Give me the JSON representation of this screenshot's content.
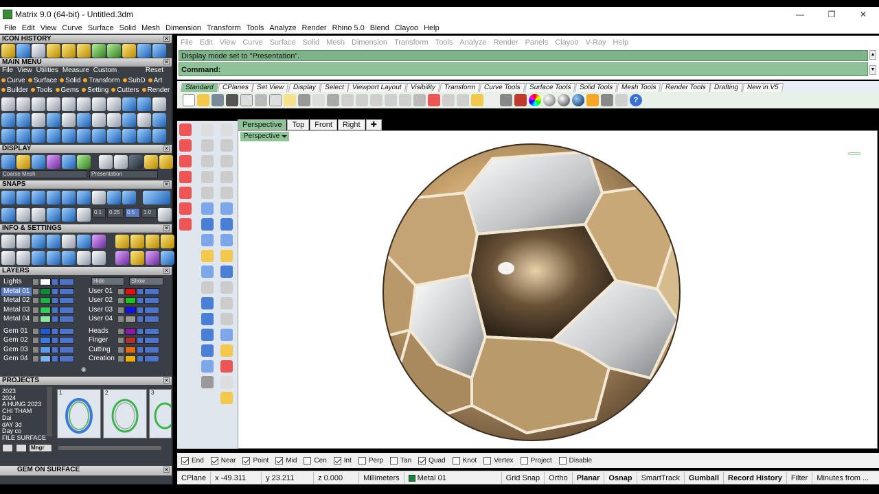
{
  "window": {
    "title": "Matrix 9.0 (64-bit) - Untitled.3dm",
    "minimize": "—",
    "maximize": "❐",
    "close": "✕"
  },
  "menu": [
    "File",
    "Edit",
    "View",
    "Curve",
    "Surface",
    "Solid",
    "Mesh",
    "Dimension",
    "Transform",
    "Tools",
    "Analyze",
    "Render",
    "Rhino 5.0",
    "Blend",
    "Clayoo",
    "Help"
  ],
  "left_panel": {
    "icon_history": "ICON HISTORY",
    "main_menu": {
      "title": "MAIN MENU",
      "items": [
        "File",
        "View",
        "Utilities",
        "Measure",
        "Custom"
      ],
      "reset": "Reset",
      "row1": [
        "Curve",
        "Surface",
        "Solid",
        "Transform",
        "SubD",
        "Art"
      ],
      "row2": [
        "Builder",
        "Tools",
        "Gems",
        "Setting",
        "Cutters",
        "Render"
      ]
    },
    "display": {
      "title": "DISPLAY",
      "mesh_combo": "Coarse Mesh",
      "mode_combo": "Presentation"
    },
    "snaps": {
      "title": "SNAPS",
      "values": [
        "0.1",
        "0.25",
        "0.5",
        "1.0"
      ]
    },
    "info": {
      "title": "INFO & SETTINGS"
    },
    "layers": {
      "title": "LAYERS",
      "lights": "Lights",
      "hide": "Hide",
      "show": "Show",
      "left": [
        {
          "name": "Metal 01",
          "color": "#0a8a3a"
        },
        {
          "name": "Metal 02",
          "color": "#1db34a"
        },
        {
          "name": "Metal 03",
          "color": "#2ecc5a"
        },
        {
          "name": "Metal 04",
          "color": "#8be8a0"
        },
        {
          "name": "Gem 01",
          "color": "#1e5bd6"
        },
        {
          "name": "Gem 02",
          "color": "#3a7be6"
        },
        {
          "name": "Gem 03",
          "color": "#5a9cf0"
        },
        {
          "name": "Gem 04",
          "color": "#7ab4f6"
        }
      ],
      "right": [
        {
          "name": "User 01",
          "color": "#e41010"
        },
        {
          "name": "User 02",
          "color": "#20c020"
        },
        {
          "name": "User 03",
          "color": "#1010e8"
        },
        {
          "name": "User 04",
          "color": "#9a9a9a"
        },
        {
          "name": "Heads",
          "color": "#8a1aa8"
        },
        {
          "name": "Finger",
          "color": "#b03030"
        },
        {
          "name": "Cutting",
          "color": "#e86a10"
        },
        {
          "name": "Creation",
          "color": "#f0b000"
        }
      ]
    },
    "projects": {
      "title": "PROJECTS",
      "list": [
        "2023",
        "2024",
        "A HUNG 2023",
        "CHI THAM",
        "Dai",
        "dAY 3d",
        "Day co",
        "FILE SURFACE"
      ],
      "thumbs": [
        "1",
        "2",
        "3"
      ],
      "mngr": "Mngr"
    },
    "gem_on_surface": "GEM ON SURFACE"
  },
  "command": {
    "menu": [
      "File",
      "Edit",
      "View",
      "Curve",
      "Surface",
      "Solid",
      "Mesh",
      "Dimension",
      "Transform",
      "Tools",
      "Analyze",
      "Render",
      "Panels",
      "Clayoo",
      "V-Ray",
      "Help"
    ],
    "history": "Display mode set to \"Presentation\".",
    "prompt": "Command:"
  },
  "toolbar_tabs": [
    "Standard",
    "CPlanes",
    "Set View",
    "Display",
    "Select",
    "Viewport Layout",
    "Visibility",
    "Transform",
    "Curve Tools",
    "Surface Tools",
    "Solid Tools",
    "Mesh Tools",
    "Render Tools",
    "Drafting",
    "New in V5"
  ],
  "viewport": {
    "tabs": [
      "Perspective",
      "Top",
      "Front",
      "Right"
    ],
    "add_tab": "✚",
    "label": "Perspective"
  },
  "osnaps": [
    {
      "label": "End",
      "on": true
    },
    {
      "label": "Near",
      "on": true
    },
    {
      "label": "Point",
      "on": true
    },
    {
      "label": "Mid",
      "on": true
    },
    {
      "label": "Cen",
      "on": false
    },
    {
      "label": "Int",
      "on": true
    },
    {
      "label": "Perp",
      "on": false
    },
    {
      "label": "Tan",
      "on": false
    },
    {
      "label": "Quad",
      "on": true
    },
    {
      "label": "Knot",
      "on": false
    },
    {
      "label": "Vertex",
      "on": false
    },
    {
      "label": "Project",
      "on": false
    },
    {
      "label": "Disable",
      "on": false
    }
  ],
  "status": {
    "cplane": "CPlane",
    "x": "x -49.311",
    "y": "y 23.211",
    "z": "z 0.000",
    "units": "Millimeters",
    "layer": "Metal 01",
    "layer_color": "#0a8a3a",
    "grid_snap": "Grid Snap",
    "ortho": "Ortho",
    "planar": "Planar",
    "osnap": "Osnap",
    "smarttrack": "SmartTrack",
    "gumball": "Gumball",
    "record_history": "Record History",
    "filter": "Filter",
    "minutes": "Minutes from ..."
  }
}
